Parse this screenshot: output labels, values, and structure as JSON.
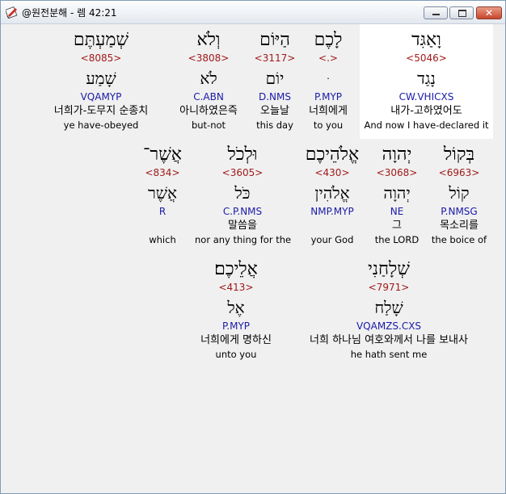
{
  "window": {
    "title": "@원전분해 - 렘 42:21",
    "close_glyph": "✕"
  },
  "rows": [
    [
      {
        "heb": "שְׁמַעְתֶּם",
        "num": "<8085>",
        "lemma": "שָׁמַע",
        "morph": "VQAMYP",
        "kor": "너희가-도무지 순종치",
        "eng": "ye have-obeyed"
      },
      {
        "heb": "וְלֹא",
        "num": "<3808>",
        "lemma": "לֹא",
        "morph": "C.ABN",
        "kor": "아니하였은즉",
        "eng": "but-not"
      },
      {
        "heb": "הַיּוֹם",
        "num": "<3117>",
        "lemma": "יוֹם",
        "morph": "D.NMS",
        "kor": "오늘날",
        "eng": "this day"
      },
      {
        "heb": "לָכֶם",
        "num": "<.>",
        "lemma": "ּ",
        "morph": "P.MYP",
        "kor": "너희에게",
        "eng": "to you"
      },
      {
        "heb": "וָאַגִּד",
        "num": "<5046>",
        "lemma": "נָגַד",
        "morph": "CW.VHICXS",
        "kor": "내가-고하였어도",
        "eng": "And now I have-declared it"
      }
    ],
    [
      {
        "heb": "אֲשֶׁר־",
        "num": "<834>",
        "lemma": "אֲשֶׁר",
        "morph": "R",
        "kor": "",
        "eng": "which"
      },
      {
        "heb": "וּלְכֹל",
        "num": "<3605>",
        "lemma": "כֹּל",
        "morph": "C.P.NMS",
        "kor": "말씀을",
        "eng": "nor any thing for the"
      },
      {
        "heb": "אֱלֹהֵיכֶם",
        "num": "<430>",
        "lemma": "אֱלֹהִין",
        "morph": "NMP.MYP",
        "kor": "",
        "eng": "your God"
      },
      {
        "heb": "יְהוָה",
        "num": "<3068>",
        "lemma": "יְהוָה",
        "morph": "NE",
        "kor": "그",
        "eng": "the LORD"
      },
      {
        "heb": "בְּקוֹל",
        "num": "<6963>",
        "lemma": "קוֹל",
        "morph": "P.NMSG",
        "kor": "목소리를",
        "eng": "the boice of"
      }
    ],
    [
      {
        "heb": "אֲלֵיכֶם׃",
        "num": "<413>",
        "lemma": "אֶל",
        "morph": "P.MYP",
        "kor": "너희에게 명하신",
        "eng": "unto you"
      },
      {
        "heb": "שְׁלָחַנִי",
        "num": "<7971>",
        "lemma": "שָׁלַח",
        "morph": "VQAMZS.CXS",
        "kor": "너희 하나님 여호와께서 나를 보내사",
        "eng": "he hath sent me"
      }
    ]
  ]
}
